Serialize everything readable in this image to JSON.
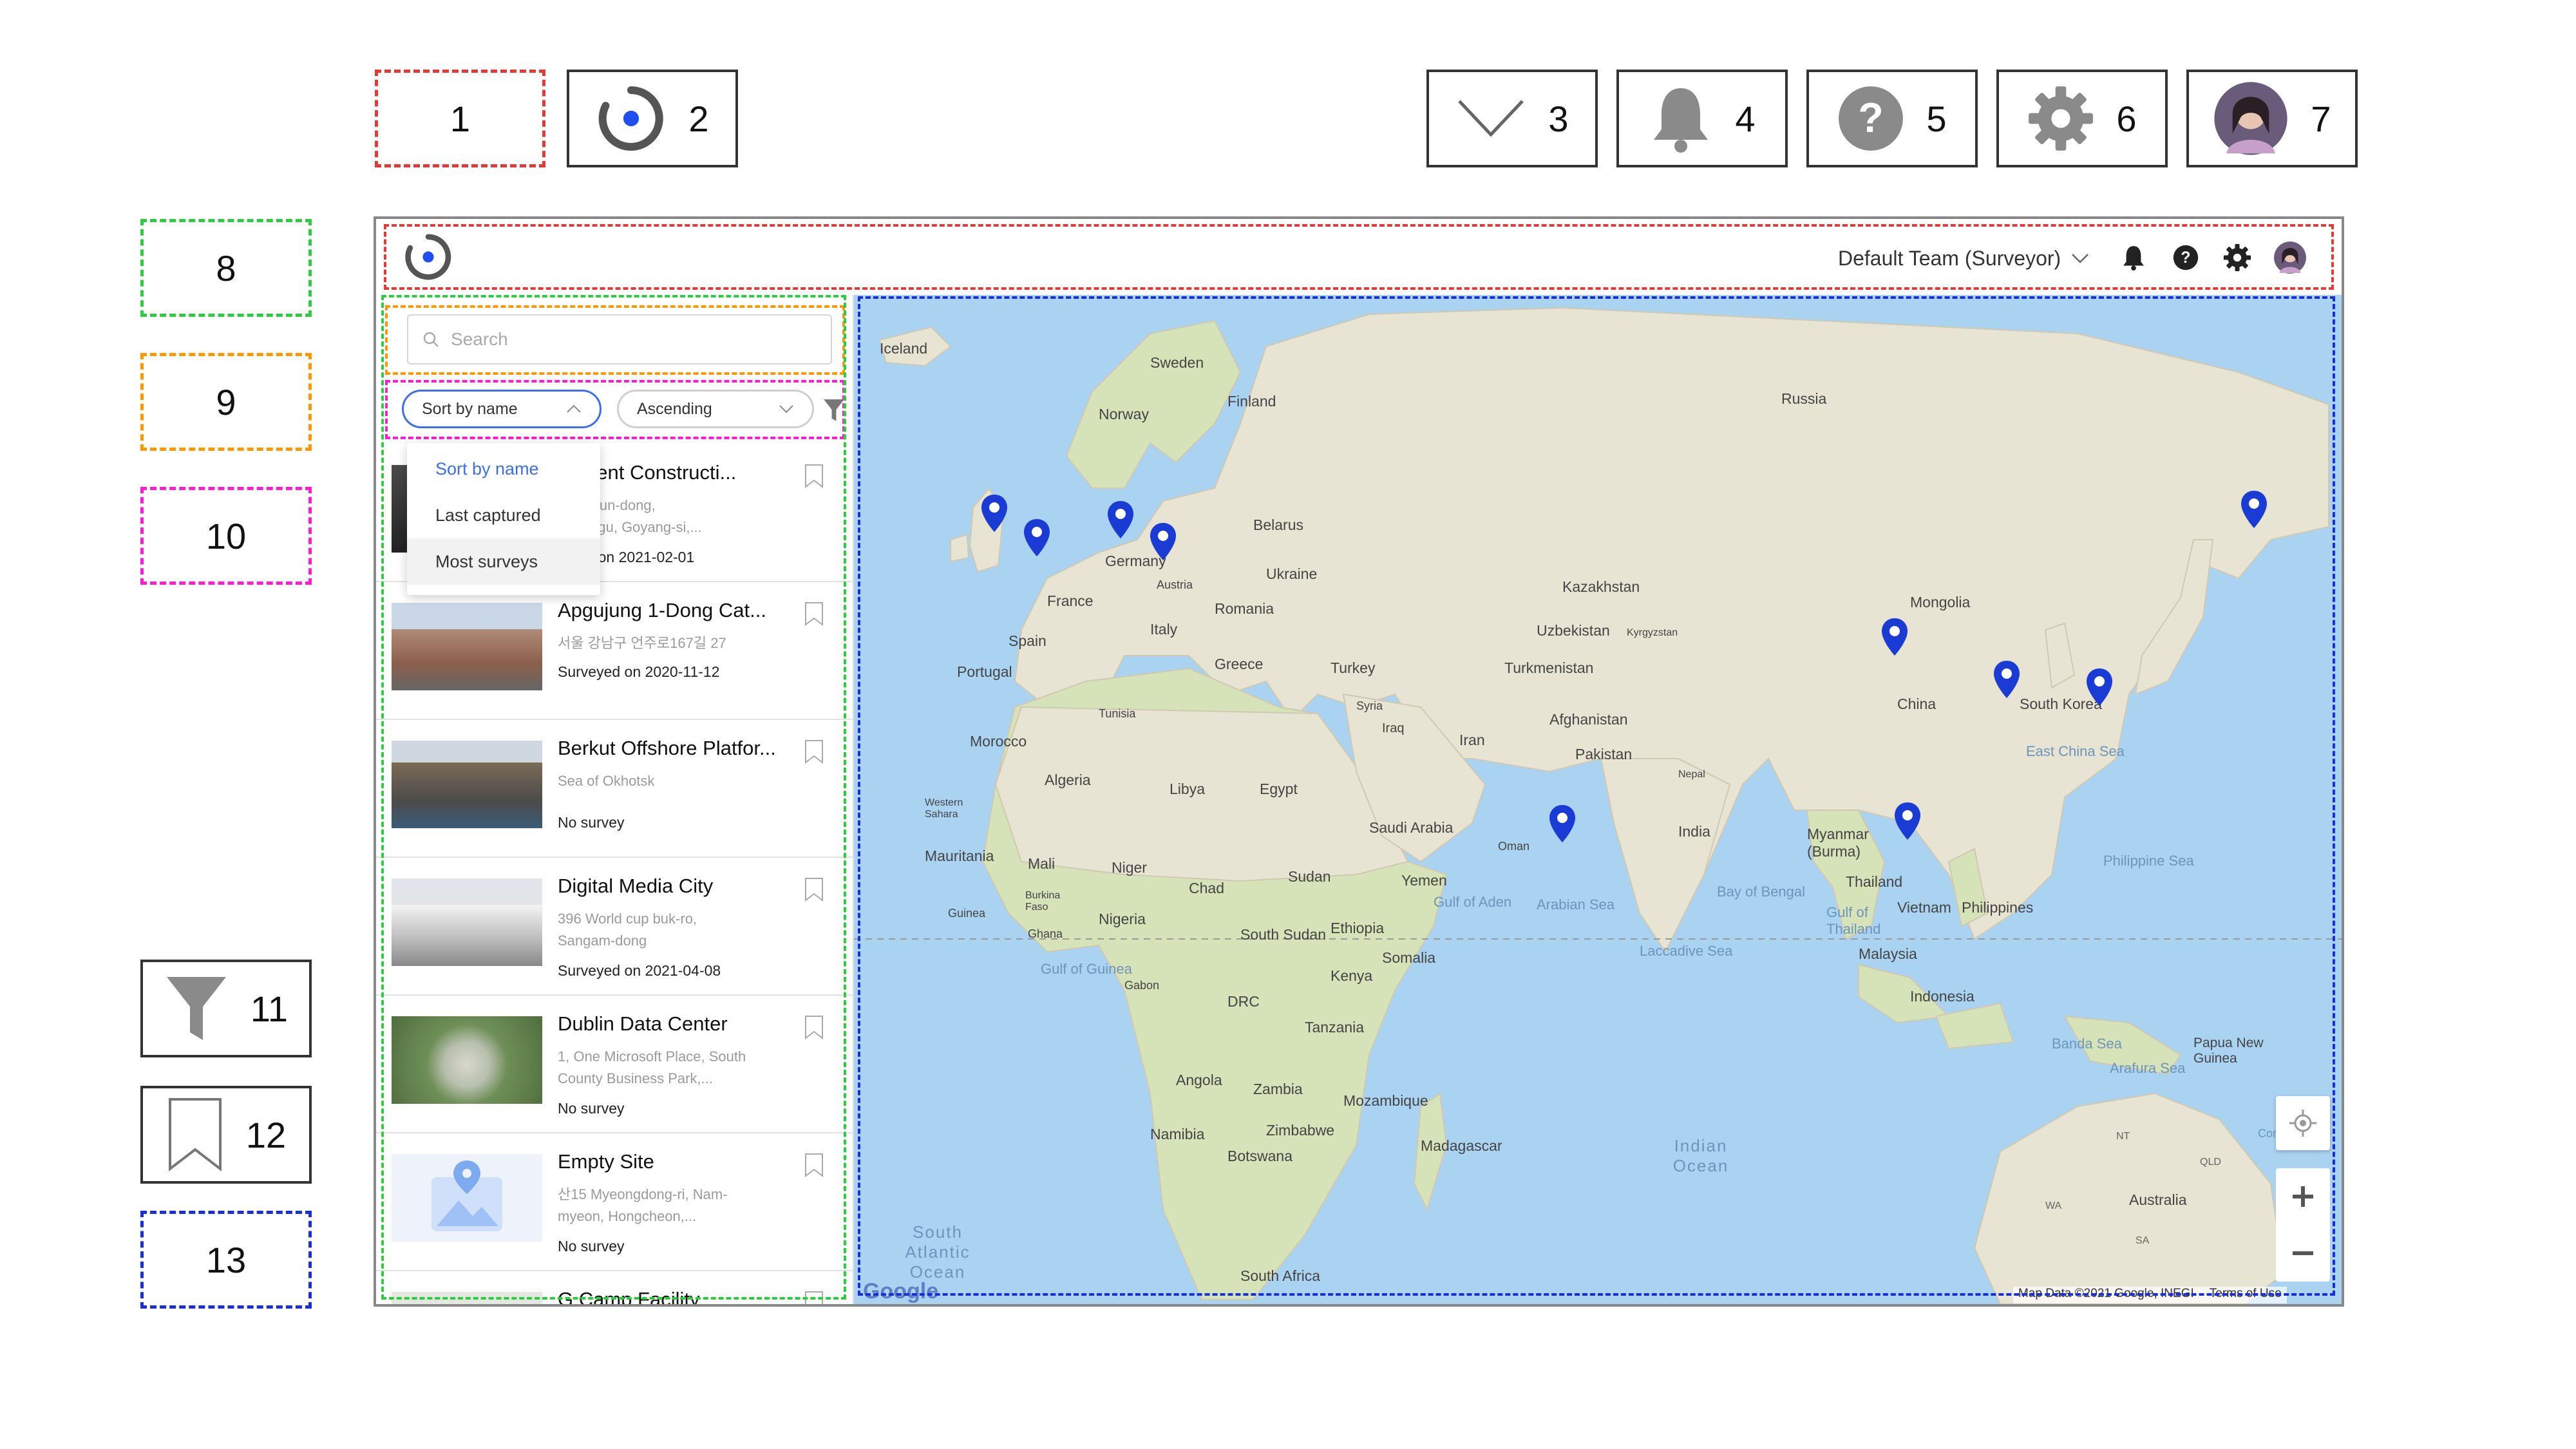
{
  "legend": {
    "top": [
      "1",
      "2",
      "3",
      "4",
      "5",
      "6",
      "7"
    ],
    "side": [
      "8",
      "9",
      "10",
      "11",
      "12",
      "13"
    ]
  },
  "topbar": {
    "team": "Default Team (Surveyor)"
  },
  "search": {
    "placeholder": "Search"
  },
  "sort": {
    "field": "Sort by name",
    "order": "Ascending",
    "options": [
      "Sort by name",
      "Last captured",
      "Most surveys"
    ]
  },
  "sites": [
    {
      "name": "...tment Constructi...",
      "addr1": "Deogeun-dong,",
      "addr2": "...ang-gu, Goyang-si,...",
      "status": "...ved on 2021-02-01"
    },
    {
      "name": "Apgujung 1-Dong Cat...",
      "addr1": "서울 강남구 언주로167길 27",
      "addr2": "",
      "status": "Surveyed on 2020-11-12"
    },
    {
      "name": "Berkut Offshore Platfor...",
      "addr1": "Sea of Okhotsk",
      "addr2": "",
      "status": "No survey"
    },
    {
      "name": "Digital Media City",
      "addr1": "396 World cup buk-ro,",
      "addr2": "Sangam-dong",
      "status": "Surveyed on 2021-04-08"
    },
    {
      "name": "Dublin Data Center",
      "addr1": "1, One Microsoft Place, South",
      "addr2": "County Business Park,...",
      "status": "No survey"
    },
    {
      "name": "Empty Site",
      "addr1": "산15 Myeongdong-ri, Nam-",
      "addr2": "myeon, Hongcheon,...",
      "status": "No survey"
    },
    {
      "name": "G Camp Facility",
      "addr1": "",
      "addr2": "",
      "status": ""
    }
  ],
  "map": {
    "labels": [
      "Iceland",
      "Sweden",
      "Finland",
      "Norway",
      "Russia",
      "Belarus",
      "Germany",
      "Ukraine",
      "Austria",
      "France",
      "Romania",
      "Kazakhstan",
      "Mongolia",
      "Spain",
      "Italy",
      "Uzbekistan",
      "Kyrgyzstan",
      "Portugal",
      "Greece",
      "Turkey",
      "Turkmenistan",
      "China",
      "South Korea",
      "Syria",
      "Afghanistan",
      "Morocco",
      "Tunisia",
      "Iraq",
      "Iran",
      "Algeria",
      "Libya",
      "Egypt",
      "Pakistan",
      "Nepal",
      "Western Sahara",
      "Saudi Arabia",
      "India",
      "Myanmar (Burma)",
      "Mauritania",
      "Mali",
      "Niger",
      "Oman",
      "Chad",
      "Sudan",
      "Yemen",
      "Thailand",
      "Vietnam",
      "Philippines",
      "Burkina Faso",
      "Guinea",
      "Nigeria",
      "South Sudan",
      "Ethiopia",
      "Ghana",
      "Somalia",
      "Malaysia",
      "Gabon",
      "Kenya",
      "DRC",
      "Indonesia",
      "Tanzania",
      "Papua New Guinea",
      "Angola",
      "Zambia",
      "Mozambique",
      "Namibia",
      "Zimbabwe",
      "Botswana",
      "Madagascar",
      "Australia",
      "South Africa"
    ],
    "seas": [
      "East China Sea",
      "Philippine Sea",
      "Gulf of Aden",
      "Arabian Sea",
      "Bay of Bengal",
      "Gulf of Thailand",
      "Laccadive Sea",
      "Gulf of Guinea",
      "Banda Sea",
      "Arafura Sea",
      "Coral S",
      "Indian Ocean",
      "South Atlantic Ocean"
    ],
    "regions": [
      "NT",
      "QLD",
      "WA",
      "SA"
    ],
    "attribution": "Map Data ©2021 Google, INEGI",
    "terms": "Terms of Use",
    "google": "Google"
  }
}
